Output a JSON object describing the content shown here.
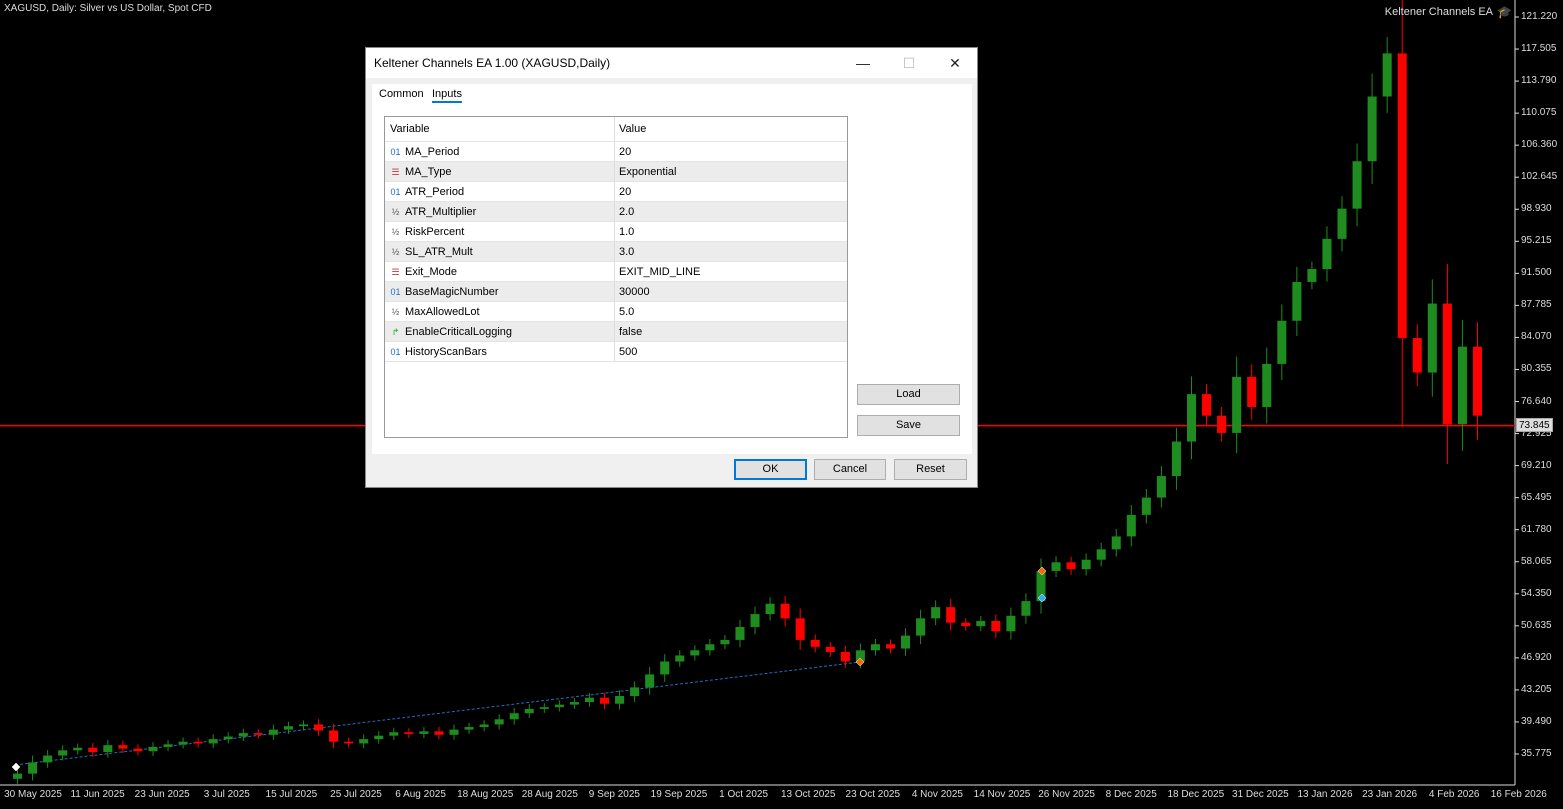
{
  "chart": {
    "symbol_title": "XAGUSD, Daily:  Silver vs US Dollar, Spot CFD",
    "ea_label": "Keltener Channels EA",
    "ea_icon": "graduation-cap-icon",
    "current_price": "73.845",
    "colors": {
      "bull": "#1e8c1e",
      "bear": "#ff0000",
      "price_line": "#ff0000",
      "trend_line": "#1e6fc0"
    }
  },
  "chart_data": {
    "type": "candlestick",
    "price_axis": [
      "121.220",
      "117.505",
      "113.790",
      "110.075",
      "106.360",
      "102.645",
      "98.930",
      "95.215",
      "91.500",
      "87.785",
      "84.070",
      "80.355",
      "76.640",
      "72.925",
      "69.210",
      "65.495",
      "61.780",
      "58.065",
      "54.350",
      "50.635",
      "46.920",
      "43.205",
      "39.490",
      "35.775"
    ],
    "date_axis": [
      "30 May 2025",
      "11 Jun 2025",
      "23 Jun 2025",
      "3 Jul 2025",
      "15 Jul 2025",
      "25 Jul 2025",
      "6 Aug 2025",
      "18 Aug 2025",
      "28 Aug 2025",
      "9 Sep 2025",
      "19 Sep 2025",
      "1 Oct 2025",
      "13 Oct 2025",
      "23 Oct 2025",
      "4 Nov 2025",
      "14 Nov 2025",
      "26 Nov 2025",
      "8 Dec 2025",
      "18 Dec 2025",
      "31 Dec 2025",
      "13 Jan 2026",
      "23 Jan 2026",
      "4 Feb 2026",
      "16 Feb 2026"
    ],
    "ylim": [
      35.775,
      121.22
    ],
    "closes": [
      33.5,
      34.8,
      35.6,
      36.2,
      36.5,
      36.0,
      36.8,
      36.4,
      36.1,
      36.6,
      36.9,
      37.2,
      37.0,
      37.5,
      37.8,
      38.2,
      38.0,
      38.6,
      39.0,
      39.2,
      38.5,
      37.2,
      37.0,
      37.5,
      37.9,
      38.3,
      38.1,
      38.4,
      38.0,
      38.6,
      38.9,
      39.2,
      39.8,
      40.5,
      41.0,
      41.2,
      41.5,
      41.8,
      42.3,
      41.6,
      42.5,
      43.5,
      45.0,
      46.5,
      47.2,
      47.8,
      48.5,
      49.0,
      50.5,
      52.0,
      53.2,
      51.5,
      49.0,
      48.2,
      47.6,
      46.5,
      47.8,
      48.5,
      48.0,
      49.5,
      51.5,
      52.8,
      51.0,
      50.6,
      51.2,
      50.0,
      51.8,
      53.5,
      57.0,
      58.0,
      57.2,
      58.3,
      59.5,
      61.0,
      63.5,
      65.5,
      68.0,
      72.0,
      77.5,
      75.0,
      73.0,
      79.5,
      76.0,
      81.0,
      86.0,
      90.5,
      92.0,
      95.5,
      99.0,
      104.5,
      112.0,
      117.0,
      84.0,
      80.0,
      88.0,
      74.0,
      83.0,
      75.0
    ],
    "price_line": 73.845
  },
  "dialog": {
    "title": "Keltener Channels EA 1.00 (XAGUSD,Daily)",
    "tabs": [
      "Common",
      "Inputs"
    ],
    "columns": [
      "Variable",
      "Value"
    ],
    "rows": [
      {
        "icon": "01",
        "name": "MA_Period",
        "value": "20"
      },
      {
        "icon": "enum",
        "name": "MA_Type",
        "value": "Exponential"
      },
      {
        "icon": "01",
        "name": "ATR_Period",
        "value": "20"
      },
      {
        "icon": "½",
        "name": "ATR_Multiplier",
        "value": "2.0"
      },
      {
        "icon": "½",
        "name": "RiskPercent",
        "value": "1.0"
      },
      {
        "icon": "½",
        "name": "SL_ATR_Mult",
        "value": "3.0"
      },
      {
        "icon": "enum",
        "name": "Exit_Mode",
        "value": "EXIT_MID_LINE"
      },
      {
        "icon": "01",
        "name": "BaseMagicNumber",
        "value": "30000"
      },
      {
        "icon": "½",
        "name": "MaxAllowedLot",
        "value": "5.0"
      },
      {
        "icon": "bool",
        "name": "EnableCriticalLogging",
        "value": "false"
      },
      {
        "icon": "01",
        "name": "HistoryScanBars",
        "value": "500"
      }
    ],
    "load": "Load",
    "save": "Save",
    "ok": "OK",
    "cancel": "Cancel",
    "reset": "Reset",
    "minimize": "—",
    "maximize": "☐",
    "close": "✕"
  }
}
